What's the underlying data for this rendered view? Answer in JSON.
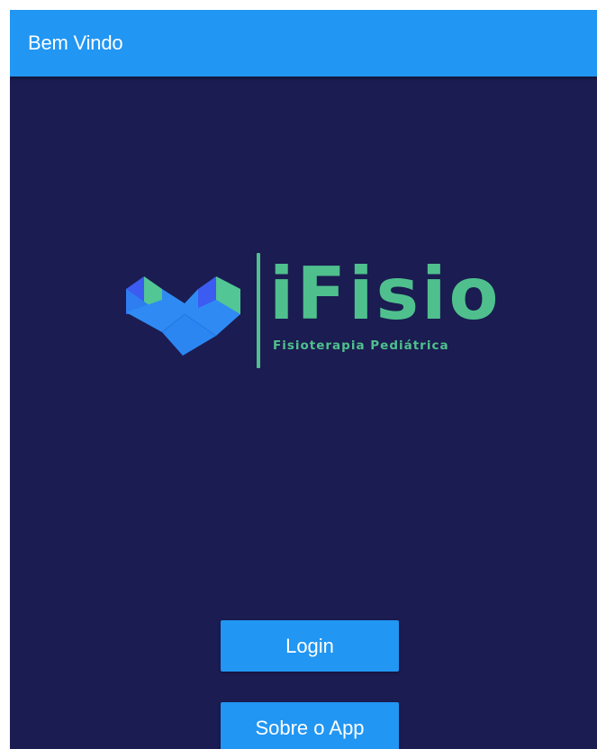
{
  "app_bar": {
    "title": "Bem Vindo"
  },
  "logo": {
    "icon": "heart-blocks-icon",
    "brand_name": "iFisio",
    "tagline": "Fisioterapia Pediátrica"
  },
  "actions": {
    "login_label": "Login",
    "about_label": "Sobre o App"
  },
  "colors": {
    "background": "#1b1c51",
    "app_bar": "#2196f3",
    "button": "#2196f3",
    "brand_green": "#4fc08d",
    "heart_dark_blue": "#3c5bf0",
    "heart_blue": "#2f8bf3",
    "heart_green": "#52c694"
  }
}
